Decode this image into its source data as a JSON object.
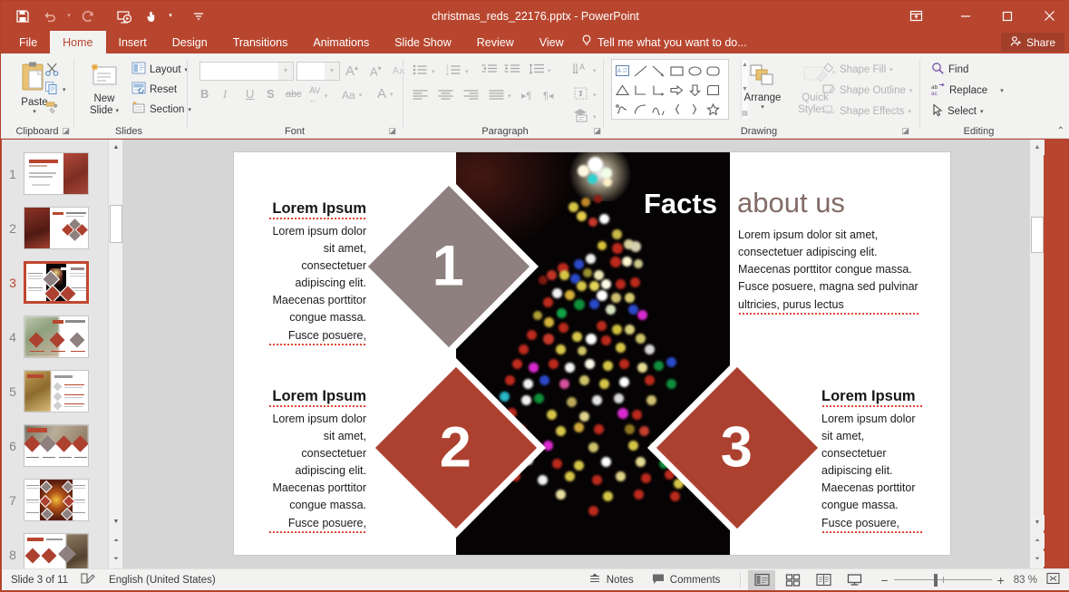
{
  "window": {
    "title": "christmas_reds_22176.pptx - PowerPoint",
    "quick_access": [
      {
        "name": "save-icon",
        "label": "Save"
      },
      {
        "name": "undo-icon",
        "label": "Undo"
      },
      {
        "name": "redo-icon",
        "label": "Redo"
      },
      {
        "name": "start-presentation-icon",
        "label": "Start From Beginning"
      },
      {
        "name": "touch-mode-icon",
        "label": "Touch/Mouse Mode"
      },
      {
        "name": "customize-qat-icon",
        "label": "Customize Quick Access Toolbar"
      }
    ],
    "controls": [
      {
        "name": "ribbon-display-options-icon",
        "label": "Ribbon Display Options"
      },
      {
        "name": "minimize-icon",
        "label": "Minimize"
      },
      {
        "name": "maximize-icon",
        "label": "Maximize"
      },
      {
        "name": "close-icon",
        "label": "Close"
      }
    ]
  },
  "ribbon": {
    "tabs": [
      {
        "label": "File",
        "active": false
      },
      {
        "label": "Home",
        "active": true
      },
      {
        "label": "Insert",
        "active": false
      },
      {
        "label": "Design",
        "active": false
      },
      {
        "label": "Transitions",
        "active": false
      },
      {
        "label": "Animations",
        "active": false
      },
      {
        "label": "Slide Show",
        "active": false
      },
      {
        "label": "Review",
        "active": false
      },
      {
        "label": "View",
        "active": false
      }
    ],
    "tell_me": "Tell me what you want to do...",
    "share": "Share",
    "groups": {
      "clipboard": {
        "label": "Clipboard",
        "paste": "Paste",
        "cut": "Cut",
        "copy": "Copy",
        "format_painter": "Format Painter"
      },
      "slides": {
        "label": "Slides",
        "new_slide": "New\nSlide",
        "new_slide_l1": "New",
        "new_slide_l2": "Slide",
        "layout": "Layout",
        "reset": "Reset",
        "section": "Section"
      },
      "font": {
        "label": "Font",
        "font_name": "",
        "font_size": "",
        "font_name_placeholder": "",
        "font_size_placeholder": "",
        "bold": "B",
        "italic": "I",
        "underline": "U",
        "shadow": "S",
        "strikethrough": "abc",
        "character_spacing": "AV",
        "change_case": "Aa",
        "font_color": "A"
      },
      "paragraph": {
        "label": "Paragraph"
      },
      "drawing": {
        "label": "Drawing",
        "arrange": "Arrange",
        "quick_styles_l1": "Quick",
        "quick_styles_l2": "Styles",
        "shape_fill": "Shape Fill",
        "shape_outline": "Shape Outline",
        "shape_effects": "Shape Effects"
      },
      "editing": {
        "label": "Editing",
        "find": "Find",
        "replace": "Replace",
        "select": "Select"
      }
    }
  },
  "slide_panel": {
    "thumbnails": [
      {
        "number": "1",
        "selected": false
      },
      {
        "number": "2",
        "selected": false
      },
      {
        "number": "3",
        "selected": true
      },
      {
        "number": "4",
        "selected": false
      },
      {
        "number": "5",
        "selected": false
      },
      {
        "number": "6",
        "selected": false
      },
      {
        "number": "7",
        "selected": false
      },
      {
        "number": "8",
        "selected": false
      }
    ]
  },
  "slide": {
    "title_bold": "Facts",
    "title_light": "about us",
    "intro_body": "Lorem ipsum dolor sit amet, consectetuer adipiscing elit. Maecenas porttitor congue massa. Fusce posuere, magna sed pulvinar ultricies, purus lectus",
    "blocks": [
      {
        "id": "block-1",
        "heading": "Lorem Ipsum",
        "body": "Lorem ipsum dolor sit amet, consectetuer adipiscing elit. Maecenas porttitor congue massa. Fusce posuere,",
        "number": "1",
        "color": "#8d807e",
        "align": "right"
      },
      {
        "id": "block-2",
        "heading": "Lorem Ipsum",
        "body": "Lorem ipsum dolor sit amet, consectetuer adipiscing elit. Maecenas porttitor congue massa. Fusce posuere,",
        "number": "2",
        "color": "#ad4130",
        "align": "right"
      },
      {
        "id": "block-3",
        "heading": "Lorem Ipsum",
        "body": "Lorem ipsum dolor sit amet, consectetuer adipiscing elit. Maecenas porttitor congue massa. Fusce posuere,",
        "number": "3",
        "color": "#ad4130",
        "align": "left"
      }
    ]
  },
  "status_bar": {
    "slide_counter": "Slide 3 of 11",
    "language": "English (United States)",
    "notes": "Notes",
    "comments": "Comments",
    "zoom_level": "83 %",
    "views": [
      {
        "name": "normal-view-icon",
        "label": "Normal",
        "active": true
      },
      {
        "name": "slide-sorter-icon",
        "label": "Slide Sorter",
        "active": false
      },
      {
        "name": "reading-view-icon",
        "label": "Reading View",
        "active": false
      },
      {
        "name": "slide-show-icon",
        "label": "Slide Show",
        "active": false
      }
    ],
    "zoom_out": "−",
    "zoom_in": "+",
    "fit_label": "Fit slide to current window"
  },
  "colors": {
    "accent": "#b8462f",
    "diamond_gray": "#8d807e",
    "diamond_red": "#ad4130",
    "title_light": "#826c66"
  }
}
